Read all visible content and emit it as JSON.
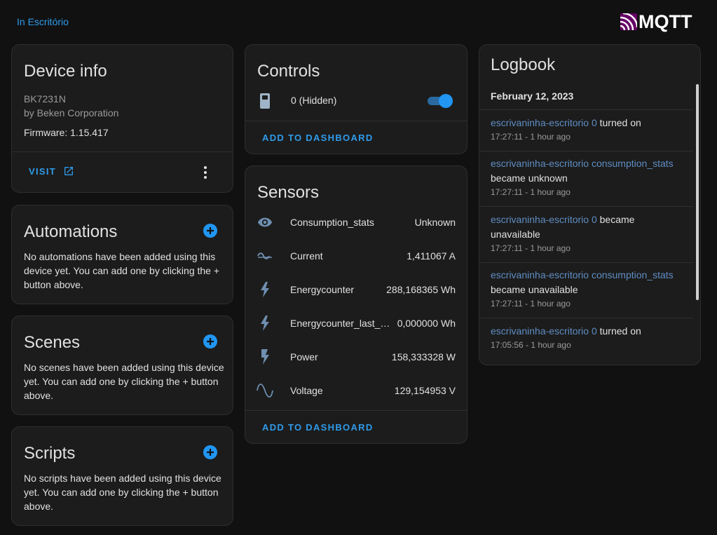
{
  "header": {
    "area_link": "In Escritório",
    "logo_text": "MQTT"
  },
  "device_info": {
    "title": "Device info",
    "model": "BK7231N",
    "manufacturer": "by Beken Corporation",
    "firmware": "Firmware: 1.15.417",
    "visit_label": "VISIT"
  },
  "automations": {
    "title": "Automations",
    "text": "No automations have been added using this device yet. You can add one by clicking the + button above."
  },
  "scenes": {
    "title": "Scenes",
    "text": "No scenes have been added using this device yet. You can add one by clicking the + button above."
  },
  "scripts": {
    "title": "Scripts",
    "text": "No scripts have been added using this device yet. You can add one by clicking the + button above."
  },
  "controls": {
    "title": "Controls",
    "item_label": "0 (Hidden)",
    "toggle_on": true,
    "add_label": "ADD TO DASHBOARD"
  },
  "sensors": {
    "title": "Sensors",
    "items": [
      {
        "icon": "eye-icon",
        "name": "Consumption_stats",
        "value": "Unknown"
      },
      {
        "icon": "current-ac-icon",
        "name": "Current",
        "value": "1,411067 A"
      },
      {
        "icon": "flash-icon",
        "name": "Energycounter",
        "value": "288,168365 Wh"
      },
      {
        "icon": "flash-icon",
        "name": "Energycounter_last_hour",
        "value": "0,000000 Wh"
      },
      {
        "icon": "flash-bold-icon",
        "name": "Power",
        "value": "158,333328 W"
      },
      {
        "icon": "sine-wave-icon",
        "name": "Voltage",
        "value": "129,154953 V"
      }
    ],
    "add_label": "ADD TO DASHBOARD"
  },
  "logbook": {
    "title": "Logbook",
    "date": "February 12, 2023",
    "entries": [
      {
        "entity": "escrivaninha-escritorio 0",
        "action": " turned on",
        "time": "17:27:11 - 1 hour ago"
      },
      {
        "entity": "escrivaninha-escritorio consumption_stats",
        "action": "became unknown",
        "time": "17:27:11 - 1 hour ago"
      },
      {
        "entity": "escrivaninha-escritorio 0",
        "action": " became unavailable",
        "time": "17:27:11 - 1 hour ago"
      },
      {
        "entity": "escrivaninha-escritorio consumption_stats",
        "action": "became unavailable",
        "time": "17:27:11 - 1 hour ago"
      },
      {
        "entity": "escrivaninha-escritorio 0",
        "action": " turned on",
        "time": "17:05:56 - 1 hour ago"
      }
    ]
  },
  "colors": {
    "background": "#111111",
    "card": "#1c1c1c",
    "accent": "#2196f3",
    "link": "#2f9bea",
    "entity_link": "#5f8dc2",
    "mqtt_purple": "#660066"
  }
}
